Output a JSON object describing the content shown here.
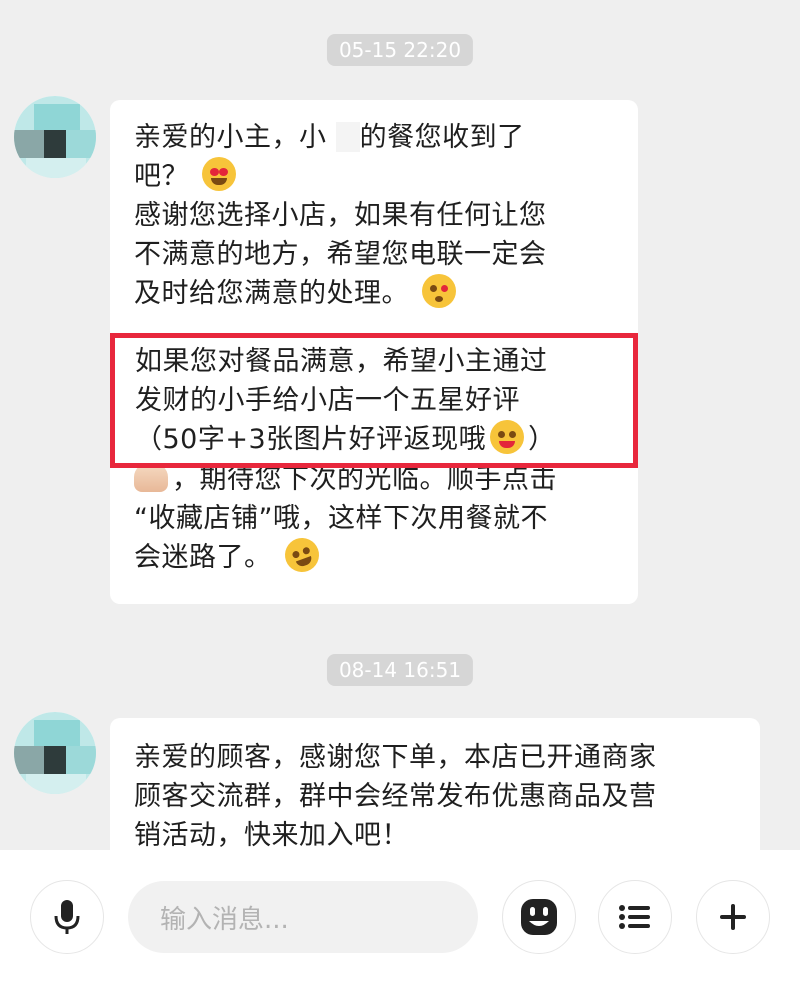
{
  "messages": [
    {
      "timestamp": "05-15 22:20",
      "paragraph1": [
        "亲爱的小主，小 ",
        "的餐您收到了",
        "吧？"
      ],
      "paragraph2": [
        "感谢您选择小店，如果有任何让您",
        "不满意的地方，希望您电联一定会",
        "及时给您满意的处理。"
      ],
      "highlight": [
        "如果您对餐品满意，希望小主通过",
        "发财的小手给小店一个五星好评",
        "（50字+3张图片好评返现哦"
      ],
      "highlight_close": "）",
      "paragraph3": [
        "，期待您下次的光临。顺手点击",
        "“收藏店铺”哦，这样下次用餐就不",
        "会迷路了。"
      ]
    },
    {
      "timestamp": "08-14 16:51",
      "lines": [
        "亲爱的顾客，感谢您下单，本店已开通商家",
        "顾客交流群，群中会经常发布优惠商品及营",
        "销活动，快来加入吧！"
      ]
    }
  ],
  "input": {
    "placeholder": "输入消息..."
  },
  "icons": {
    "voice": "microphone-icon",
    "emoji": "emoji-icon",
    "menu": "list-icon",
    "add": "plus-icon"
  },
  "colors": {
    "background": "#efefef",
    "bubble": "#ffffff",
    "highlight_border": "#e8273c",
    "timestamp_bg": "#d6d6d6",
    "avatar_teal": "#8fd6d6"
  }
}
